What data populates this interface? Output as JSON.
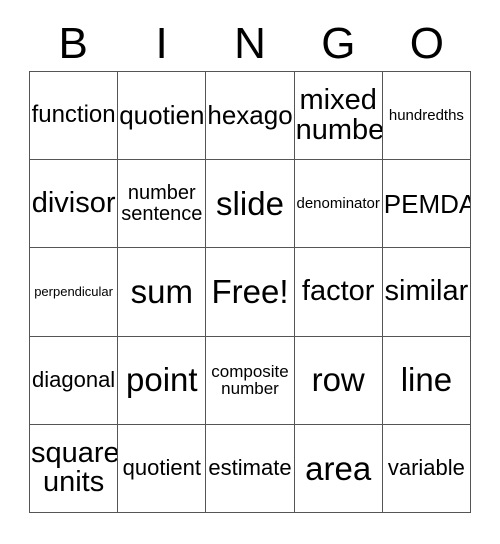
{
  "card": {
    "title": "BINGO",
    "header_letters": [
      "B",
      "I",
      "N",
      "G",
      "O"
    ],
    "grid_size": "5x5",
    "free_space": "Free!",
    "colors": {
      "background": "#ffffff",
      "text": "#000000",
      "grid_line": "#555555"
    }
  },
  "grid": {
    "rows": [
      {
        "cells": [
          {
            "text": "function",
            "size": "lg"
          },
          {
            "text": "quotient",
            "size": "lgr"
          },
          {
            "text": "hexagon",
            "size": "lgr"
          },
          {
            "text": "mixed\nnumber",
            "size": "xl"
          },
          {
            "text": "hundredths",
            "size": "sm"
          }
        ]
      },
      {
        "cells": [
          {
            "text": "divisor",
            "size": "xl"
          },
          {
            "text": "number\nsentence",
            "size": "md"
          },
          {
            "text": "slide",
            "size": "xxl"
          },
          {
            "text": "denominator",
            "size": "sm"
          },
          {
            "text": "PEMDAS",
            "size": "lgr"
          }
        ]
      },
      {
        "cells": [
          {
            "text": "perpendicular",
            "size": "xs"
          },
          {
            "text": "sum",
            "size": "xxl"
          },
          {
            "text": "Free!",
            "size": "xxl"
          },
          {
            "text": "factor",
            "size": "xl"
          },
          {
            "text": "similar",
            "size": "xl"
          }
        ]
      },
      {
        "cells": [
          {
            "text": "diagonal",
            "size": "mdl"
          },
          {
            "text": "point",
            "size": "xxl"
          },
          {
            "text": "composite\nnumber",
            "size": "smm"
          },
          {
            "text": "row",
            "size": "xxl"
          },
          {
            "text": "line",
            "size": "xxl"
          }
        ]
      },
      {
        "cells": [
          {
            "text": "square\nunits",
            "size": "xl"
          },
          {
            "text": "quotient",
            "size": "mdl"
          },
          {
            "text": "estimate",
            "size": "mdl"
          },
          {
            "text": "area",
            "size": "xxl"
          },
          {
            "text": "variable",
            "size": "mdl"
          }
        ]
      }
    ]
  }
}
